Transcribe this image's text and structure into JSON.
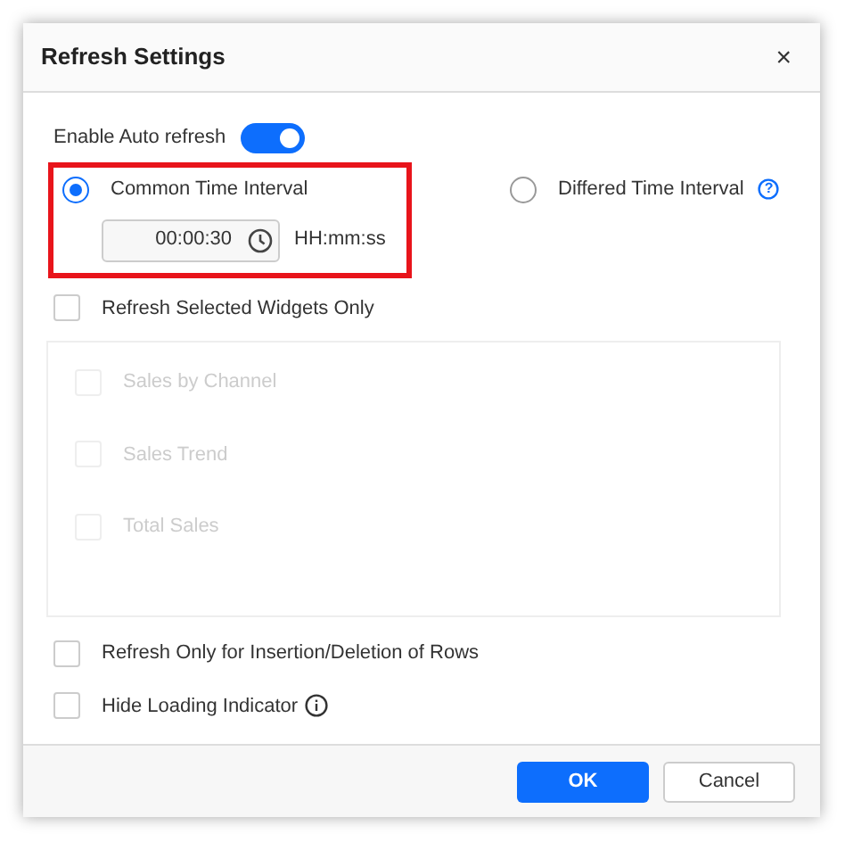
{
  "dialog": {
    "title": "Refresh Settings",
    "close": "×"
  },
  "auto_refresh": {
    "label": "Enable Auto refresh",
    "on": true
  },
  "interval_modes": [
    {
      "label": "Common Time Interval",
      "selected": true,
      "highlighted": true
    },
    {
      "label": "Differed Time Interval",
      "selected": false,
      "help": "?"
    }
  ],
  "time_field": {
    "value": "00:00:30",
    "format": "HH:mm:ss"
  },
  "options": [
    {
      "kind": "group",
      "label": "Refresh Selected Widgets Only",
      "checked": false,
      "widgets": [
        {
          "label": "Sales by Channel",
          "checked": false,
          "disabled": true
        },
        {
          "label": "Sales Trend",
          "checked": false,
          "disabled": true
        },
        {
          "label": "Total Sales",
          "checked": false,
          "disabled": true
        }
      ]
    },
    {
      "kind": "plain",
      "label": "Refresh Only for Insertion/Deletion of Rows",
      "checked": false
    },
    {
      "kind": "info",
      "label": "Hide Loading Indicator",
      "checked": false
    }
  ],
  "buttons": [
    {
      "label": "OK",
      "primary": true
    },
    {
      "label": "Cancel",
      "primary": false
    }
  ]
}
